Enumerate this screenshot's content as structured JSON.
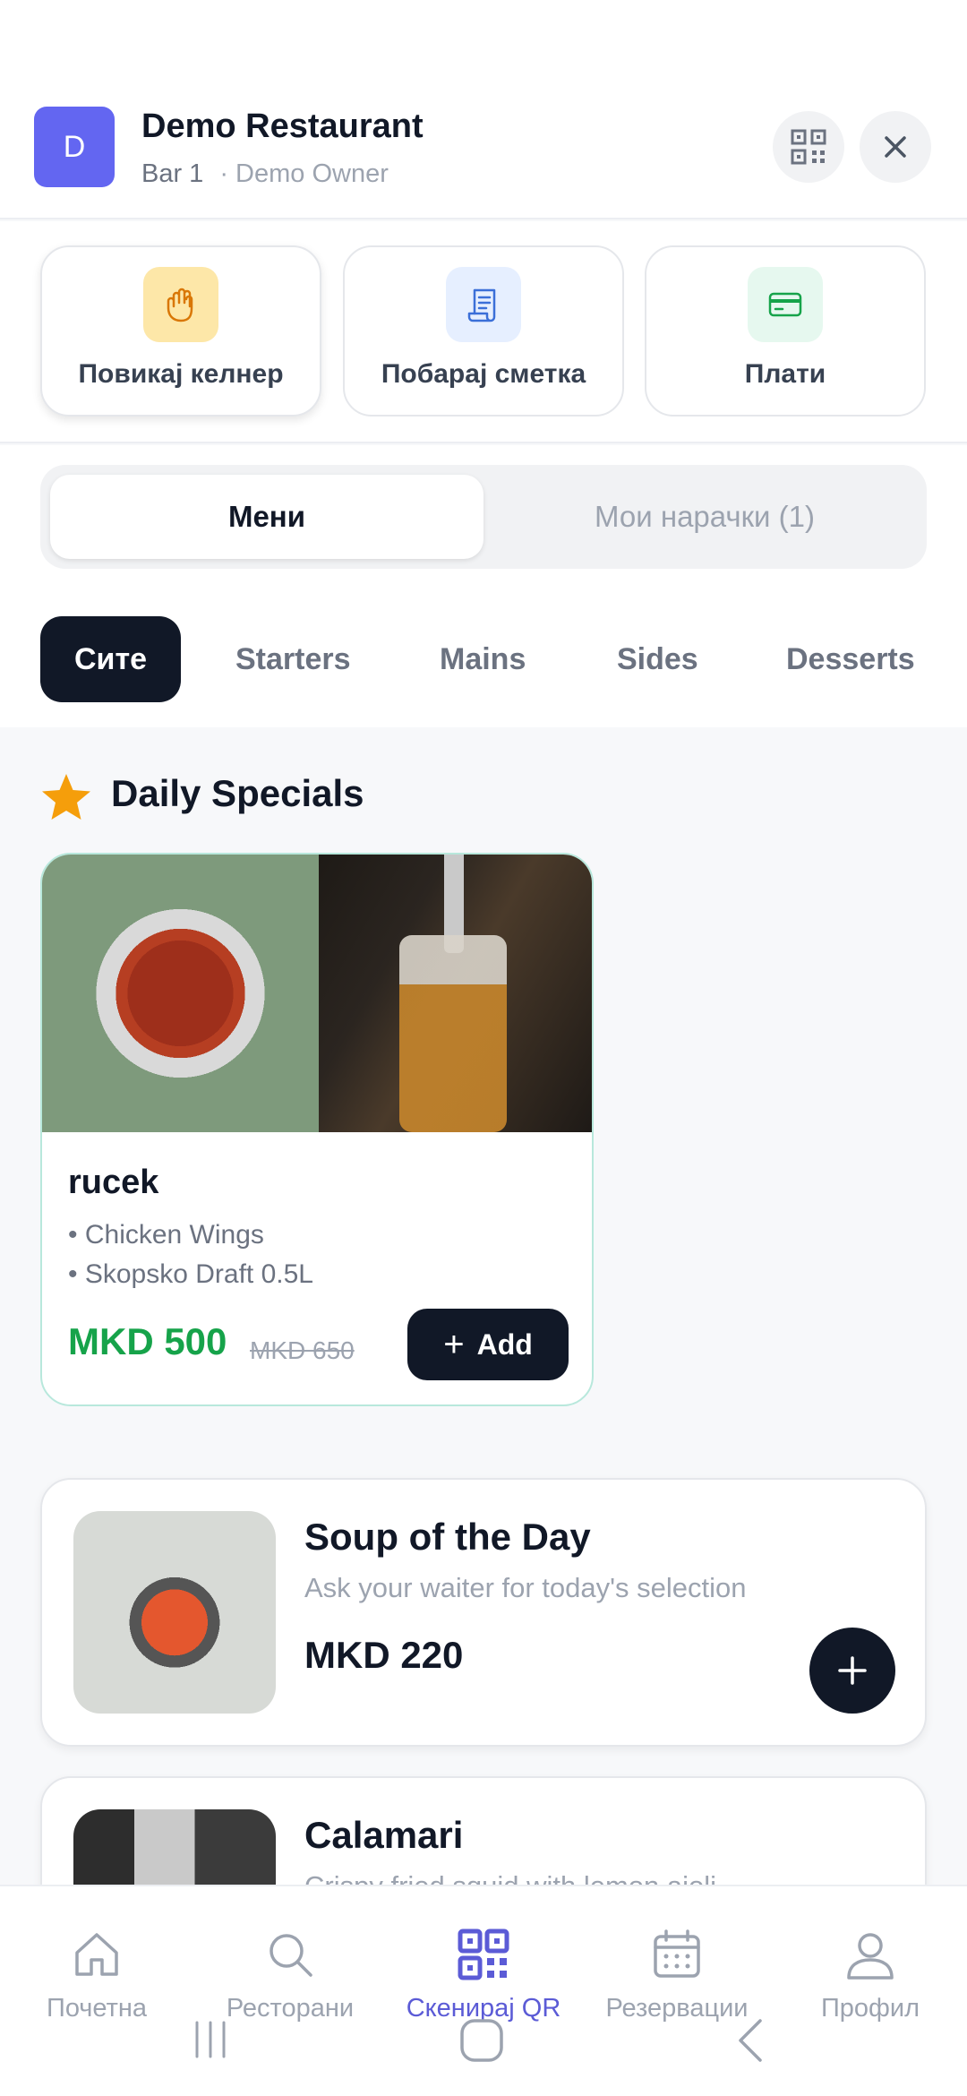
{
  "header": {
    "avatar_letter": "D",
    "restaurant_name": "Demo Restaurant",
    "table": "Bar 1",
    "owner": "· Demo Owner"
  },
  "actions": [
    {
      "label": "Повикај келнер",
      "icon": "hand-icon",
      "color": "#fde7a8"
    },
    {
      "label": "Побарај сметка",
      "icon": "receipt-icon",
      "color": "#e6efff"
    },
    {
      "label": "Плати",
      "icon": "card-icon",
      "color": "#e6f8ef"
    }
  ],
  "tabs": {
    "menu": "Мени",
    "orders": "Мои нарачки (1)"
  },
  "categories": [
    "Сите",
    "Starters",
    "Mains",
    "Sides",
    "Desserts"
  ],
  "specials": {
    "title": "Daily Specials",
    "card": {
      "name": "rucek",
      "items": [
        "• Chicken Wings",
        "• Skopsko Draft 0.5L"
      ],
      "price": "MKD 500",
      "old_price": "MKD 650",
      "add_label": "Add"
    }
  },
  "menu_items": [
    {
      "name": "Soup of the Day",
      "description": "Ask your waiter for today's selection",
      "price": "MKD 220"
    },
    {
      "name": "Calamari",
      "description": "Crispy fried squid with lemon aioli",
      "price": ""
    }
  ],
  "bottom_nav": [
    {
      "label": "Почетна",
      "icon": "home-icon"
    },
    {
      "label": "Ресторани",
      "icon": "search-icon"
    },
    {
      "label": "Скенирај QR",
      "icon": "qr-icon",
      "active": true
    },
    {
      "label": "Резервации",
      "icon": "calendar-icon"
    },
    {
      "label": "Профил",
      "icon": "user-icon"
    }
  ],
  "colors": {
    "accent": "#6366f1",
    "dark": "#111827",
    "price_green": "#16a34a",
    "nav_active": "#5b5bd6"
  }
}
